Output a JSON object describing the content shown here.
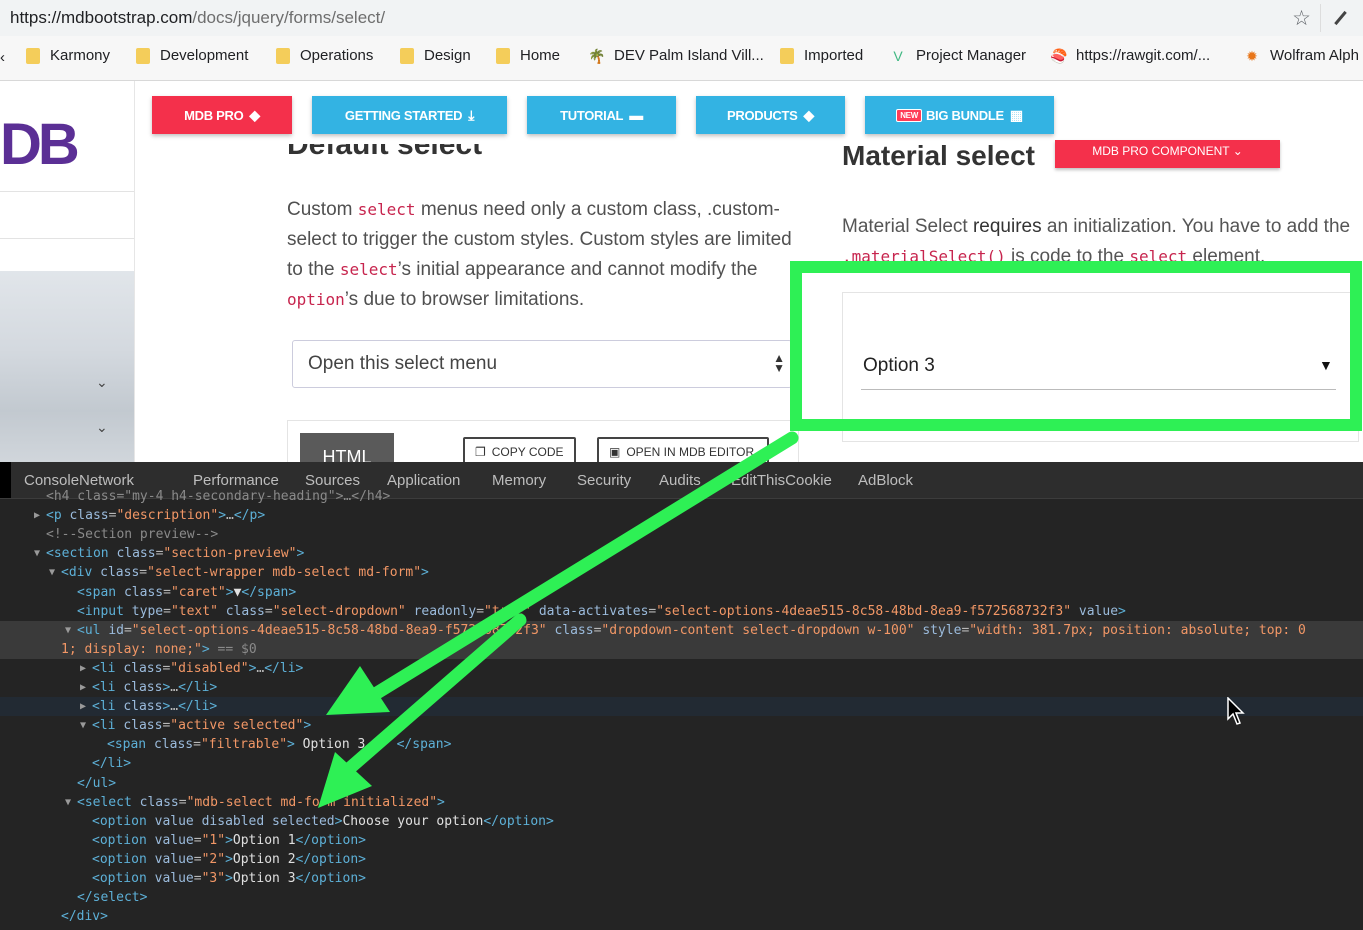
{
  "browser": {
    "url_host": "https://mdbootstrap.com",
    "url_path": "/docs/jquery/forms/select/",
    "bookmarks": [
      {
        "label": "Karmony",
        "icon": "folder"
      },
      {
        "label": "Development",
        "icon": "folder"
      },
      {
        "label": "Operations",
        "icon": "folder"
      },
      {
        "label": "Design",
        "icon": "folder"
      },
      {
        "label": "Home",
        "icon": "folder"
      },
      {
        "label": "DEV Palm Island Vill...",
        "icon": "palm-tree"
      },
      {
        "label": "Imported",
        "icon": "folder"
      },
      {
        "label": "Project Manager",
        "icon": "vue-logo"
      },
      {
        "label": "https://rawgit.com/...",
        "icon": "sushi"
      },
      {
        "label": "Wolfram Alph",
        "icon": "wolfram-star"
      }
    ]
  },
  "sidebar": {
    "logo": "DB"
  },
  "nav": {
    "mdb_pro": "MDB PRO",
    "getting_started": "GETTING STARTED",
    "tutorial": "TUTORIAL",
    "products": "PRODUCTS",
    "big_bundle_badge": "NEW",
    "big_bundle": "BIG BUNDLE"
  },
  "default_select": {
    "heading": "Default select",
    "para_1": "Custom ",
    "code_1": "select",
    "para_2": " menus need only a custom class, .custom-select to trigger the custom styles. Custom styles are limited to the ",
    "code_2": "select",
    "para_3": "’s initial appearance and cannot modify the ",
    "code_3": "option",
    "para_4": "’s due to browser limitations.",
    "select_value": "Open this select menu",
    "html_tab": "HTML",
    "copy_code": "COPY CODE",
    "open_in_editor": "OPEN IN MDB EDITOR"
  },
  "material_select": {
    "heading": "Material select",
    "badge": "MDB PRO COMPONENT",
    "para_1": "Material Select ",
    "para_bold": "requires",
    "para_2": " an initialization. You have to add the ",
    "code_1": ".materialSelect()",
    "para_3": " js code to the ",
    "code_2": "select",
    "para_4": " element.",
    "selected_value": "Option 3"
  },
  "devtools": {
    "tabs": [
      "Console",
      "Network",
      "Performance",
      "Sources",
      "Application",
      "Memory",
      "Security",
      "Audits",
      "EditThisCookie",
      "AdBlock"
    ],
    "lines": [
      {
        "indent": 46,
        "tri": "",
        "html": "<span class='cm'>&lt;h4 class=\"my-4 h4-secondary-heading\"&gt;…&lt;/h4&gt;</span>"
      },
      {
        "indent": 46,
        "tri": "▶",
        "html": "<span class='tag'>&lt;p</span> <span class='an'>class</span>=<span class='av'>\"description\"</span><span class='tag'>&gt;</span>…<span class='tag'>&lt;/p&gt;</span>"
      },
      {
        "indent": 46,
        "tri": "",
        "html": "<span class='cm'>&lt;!--Section preview--&gt;</span>"
      },
      {
        "indent": 46,
        "tri": "▼",
        "html": "<span class='tag'>&lt;section</span> <span class='an'>class</span>=<span class='av'>\"section-preview\"</span><span class='tag'>&gt;</span>"
      },
      {
        "indent": 61,
        "tri": "▼",
        "html": "<span class='tag'>&lt;div</span> <span class='an'>class</span>=<span class='av'>\"select-wrapper mdb-select md-form\"</span><span class='tag'>&gt;</span>"
      },
      {
        "indent": 77,
        "tri": "",
        "html": "<span class='tag'>&lt;span</span> <span class='an'>class</span>=<span class='av'>\"caret\"</span><span class='tag'>&gt;</span><span class='tx'>▼</span><span class='tag'>&lt;/span&gt;</span>"
      },
      {
        "indent": 77,
        "tri": "",
        "html": "<span class='tag'>&lt;input</span> <span class='an'>type</span>=<span class='av'>\"text\"</span> <span class='an'>class</span>=<span class='av'>\"select-dropdown\"</span> <span class='an'>readonly</span>=<span class='av'>\"true\"</span> <span class='an'>data-activates</span>=<span class='av'>\"select-options-4deae515-8c58-48bd-8ea9-f572568732f3\"</span> <span class='an'>value</span><span class='tag'>&gt;</span>"
      },
      {
        "indent": 77,
        "tri": "▼",
        "hl": 1,
        "html": "<span class='tag'>&lt;ul</span> <span class='an'>id</span>=<span class='av'>\"select-options-4deae515-8c58-48bd-8ea9-f572568732f3\"</span> <span class='an'>class</span>=<span class='av'>\"dropdown-content select-dropdown w-100\"</span> <span class='an'>style</span>=<span class='av'>\"width: 381.7px; position: absolute; top: 0</span>"
      },
      {
        "indent": 61,
        "tri": "",
        "hl": 1,
        "html": "<span class='av'>1; display: none;\"</span><span class='tag'>&gt;</span> <span class='cm'>== $0</span>"
      },
      {
        "indent": 92,
        "tri": "▶",
        "html": "<span class='tag'>&lt;li</span> <span class='an'>class</span>=<span class='av'>\"disabled\"</span><span class='tag'>&gt;</span>…<span class='tag'>&lt;/li&gt;</span>"
      },
      {
        "indent": 92,
        "tri": "▶",
        "html": "<span class='tag'>&lt;li</span> <span class='an'>class</span><span class='tag'>&gt;</span>…<span class='tag'>&lt;/li&gt;</span>"
      },
      {
        "indent": 92,
        "tri": "▶",
        "hl": 2,
        "html": "<span class='tag'>&lt;li</span> <span class='an'>class</span><span class='tag'>&gt;</span>…<span class='tag'>&lt;/li&gt;</span>"
      },
      {
        "indent": 92,
        "tri": "▼",
        "html": "<span class='tag'>&lt;li</span> <span class='an'>class</span>=<span class='av'>\"active selected\"</span><span class='tag'>&gt;</span>"
      },
      {
        "indent": 107,
        "tri": "",
        "html": "<span class='tag'>&lt;span</span> <span class='an'>class</span>=<span class='av'>\"filtrable\"</span><span class='tag'>&gt;</span><span class='tx'> Option 3    </span><span class='tag'>&lt;/span&gt;</span>"
      },
      {
        "indent": 92,
        "tri": "",
        "html": "<span class='tag'>&lt;/li&gt;</span>"
      },
      {
        "indent": 77,
        "tri": "",
        "html": "<span class='tag'>&lt;/ul&gt;</span>"
      },
      {
        "indent": 77,
        "tri": "▼",
        "html": "<span class='tag'>&lt;select</span> <span class='an'>class</span>=<span class='av'>\"mdb-select md-form initialized\"</span><span class='tag'>&gt;</span>"
      },
      {
        "indent": 92,
        "tri": "",
        "html": "<span class='tag'>&lt;option</span> <span class='an'>value disabled selected</span><span class='tag'>&gt;</span><span class='tx'>Choose your option</span><span class='tag'>&lt;/option&gt;</span>"
      },
      {
        "indent": 92,
        "tri": "",
        "html": "<span class='tag'>&lt;option</span> <span class='an'>value</span>=<span class='av'>\"1\"</span><span class='tag'>&gt;</span><span class='tx'>Option 1</span><span class='tag'>&lt;/option&gt;</span>"
      },
      {
        "indent": 92,
        "tri": "",
        "html": "<span class='tag'>&lt;option</span> <span class='an'>value</span>=<span class='av'>\"2\"</span><span class='tag'>&gt;</span><span class='tx'>Option 2</span><span class='tag'>&lt;/option&gt;</span>"
      },
      {
        "indent": 92,
        "tri": "",
        "html": "<span class='tag'>&lt;option</span> <span class='an'>value</span>=<span class='av'>\"3\"</span><span class='tag'>&gt;</span><span class='tx'>Option 3</span><span class='tag'>&lt;/option&gt;</span>"
      },
      {
        "indent": 77,
        "tri": "",
        "html": "<span class='tag'>&lt;/select&gt;</span>"
      },
      {
        "indent": 61,
        "tri": "",
        "html": "<span class='tag'>&lt;/div&gt;</span>"
      }
    ]
  },
  "colors": {
    "highlight_green": "#2ef055",
    "mdb_red": "#f4304b",
    "mdb_blue": "#33b3e3"
  }
}
